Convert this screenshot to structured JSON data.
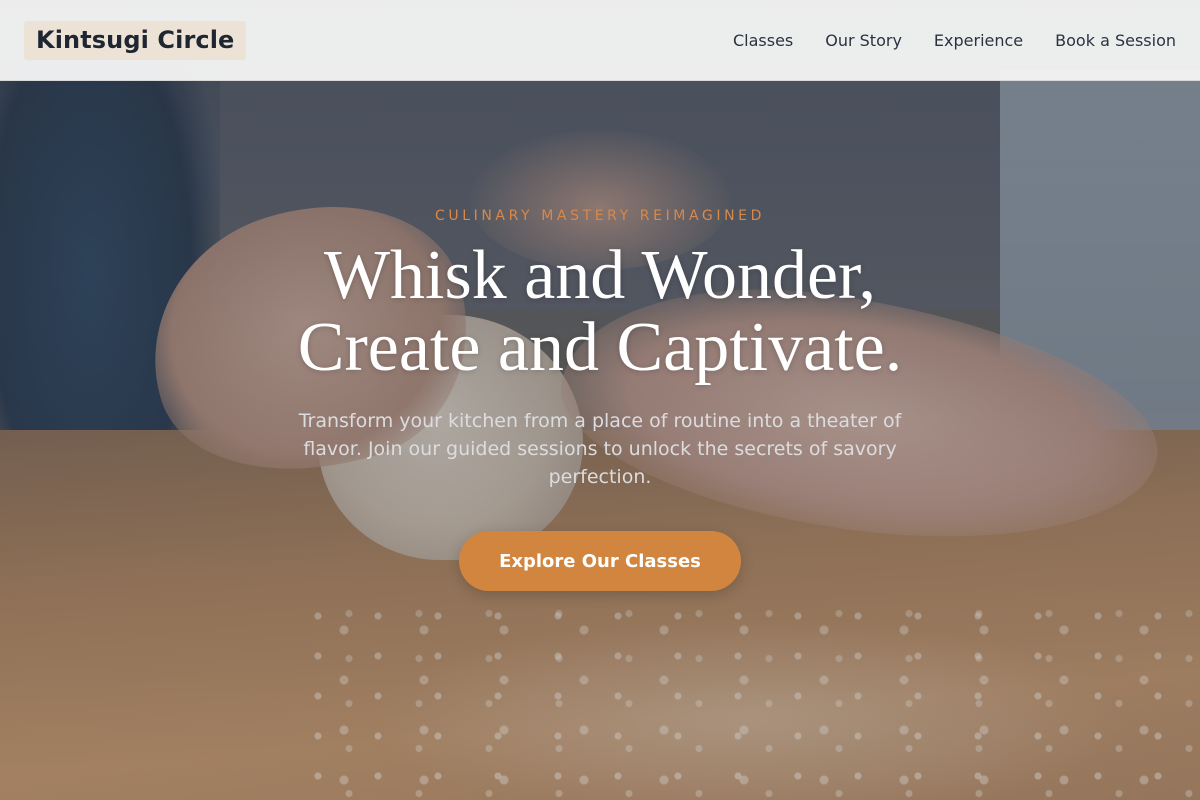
{
  "header": {
    "logo": "Kintsugi Circle",
    "nav": [
      {
        "label": "Classes"
      },
      {
        "label": "Our Story"
      },
      {
        "label": "Experience"
      },
      {
        "label": "Book a Session"
      }
    ]
  },
  "hero": {
    "eyebrow": "CULINARY MASTERY REIMAGINED",
    "headline_line1": "Whisk and Wonder,",
    "headline_line2": "Create and Captivate.",
    "subtext": "Transform your kitchen from a place of routine into a theater of flavor. Join our guided sessions to unlock the secrets of savory perfection.",
    "cta_label": "Explore Our Classes",
    "background_image": "hands-kneading-dough-photo"
  },
  "colors": {
    "accent": "#d2853f",
    "eyebrow": "#d7894a",
    "header_bg": "#f4f4f4",
    "text_dark": "#2b3340",
    "logo_bg": "#ece3d6"
  }
}
